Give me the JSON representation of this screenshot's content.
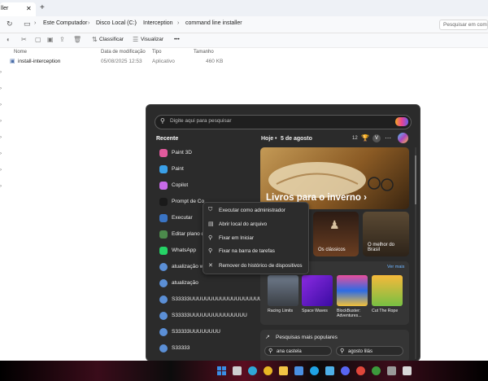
{
  "explorer": {
    "tab_title": "ller",
    "new_tab": "+",
    "breadcrumbs": [
      "Este Computador",
      "Disco Local (C:)",
      "Interception",
      "command line installer"
    ],
    "search_placeholder": "Pesquisar em comm",
    "toolbar": {
      "sort_label": "Classificar",
      "view_label": "Visualizar",
      "more_label": "•••"
    },
    "columns": {
      "name": "Nome",
      "date": "Data de modificação",
      "type": "Tipo",
      "size": "Tamanho"
    },
    "files": [
      {
        "name": "install-interception",
        "date": "05/08/2025 12:53",
        "type": "Aplicativo",
        "size": "460 KB"
      }
    ]
  },
  "start_menu": {
    "search_placeholder": "Digite aqui para pesquisar",
    "recent_title": "Recente",
    "recent_items": [
      {
        "label": "Paint 3D",
        "icon": "paint3d-icon",
        "color": "#e05a9c"
      },
      {
        "label": "Paint",
        "icon": "paint-icon",
        "color": "#3aa0e8"
      },
      {
        "label": "Copilot",
        "icon": "copilot-icon",
        "color": "#c86be8"
      },
      {
        "label": "Prompt de Co",
        "icon": "cmd-icon",
        "color": "#1a1a1a"
      },
      {
        "label": "Executar",
        "icon": "run-icon",
        "color": "#3a74c4"
      },
      {
        "label": "Editar plano de",
        "icon": "power-plan-icon",
        "color": "#4c8a4c"
      },
      {
        "label": "WhatsApp",
        "icon": "whatsapp-icon",
        "color": "#25d366"
      },
      {
        "label": "atualização win",
        "icon": "search-result-icon",
        "color": "#5b8fd6"
      },
      {
        "label": "atualização",
        "icon": "search-result-icon",
        "color": "#5b8fd6"
      },
      {
        "label": "S33333UUUUUUUUUUUUUUUUUUUUUUUUU",
        "icon": "search-result-icon",
        "color": "#5b8fd6"
      },
      {
        "label": "S33333UUUUUUUUUUUUUUU",
        "icon": "search-result-icon",
        "color": "#5b8fd6"
      },
      {
        "label": "S33333UUUUUUUU",
        "icon": "search-result-icon",
        "color": "#5b8fd6"
      },
      {
        "label": "S33333",
        "icon": "search-result-icon",
        "color": "#5b8fd6"
      }
    ],
    "today_header": "Hoje",
    "today_date": "5 de agosto",
    "weather": "12",
    "avatar_letter": "V",
    "hero_title": "Livros para o inverno",
    "cards": [
      {
        "title": "Os clássicos"
      },
      {
        "title": "O melhor do Brasil"
      }
    ],
    "games_more": "Ver mais",
    "games": [
      {
        "title": "Racing Limits"
      },
      {
        "title": "Space Waves"
      },
      {
        "title": "BlockBuster: Adventures..."
      },
      {
        "title": "Cut The Rope"
      }
    ],
    "popular_title": "Pesquisas mais populares",
    "popular_searches": [
      "ana castela",
      "agosto lilás"
    ]
  },
  "context_menu": {
    "items": [
      {
        "label": "Executar como administrador",
        "icon": "admin-icon"
      },
      {
        "label": "Abrir local do arquivo",
        "icon": "open-folder-icon"
      },
      {
        "label": "Fixar em Iniciar",
        "icon": "pin-icon"
      },
      {
        "label": "Fixar na barra de tarefas",
        "icon": "pin-taskbar-icon"
      },
      {
        "label": "Remover do histórico de dispositivos",
        "icon": "remove-icon"
      }
    ]
  },
  "taskbar": {
    "icons": [
      {
        "name": "windows-start-icon",
        "color": "#3a8ee6"
      },
      {
        "name": "search-icon",
        "color": "#cfcfcf"
      },
      {
        "name": "edge-icon",
        "color": "#2fa7d6"
      },
      {
        "name": "chrome-icon",
        "color": "#e8b623"
      },
      {
        "name": "file-explorer-icon",
        "color": "#f2c545"
      },
      {
        "name": "store-icon",
        "color": "#4a90e2"
      },
      {
        "name": "skype-icon",
        "color": "#1fa3e4"
      },
      {
        "name": "photos-icon",
        "color": "#4eb0e8"
      },
      {
        "name": "discord-icon",
        "color": "#5865f2"
      },
      {
        "name": "ccleaner-icon",
        "color": "#e0463a"
      },
      {
        "name": "app-icon-1",
        "color": "#3c9a3c"
      },
      {
        "name": "app-icon-2",
        "color": "#9a9a9a"
      },
      {
        "name": "app-icon-3",
        "color": "#d8d8d8"
      }
    ]
  }
}
